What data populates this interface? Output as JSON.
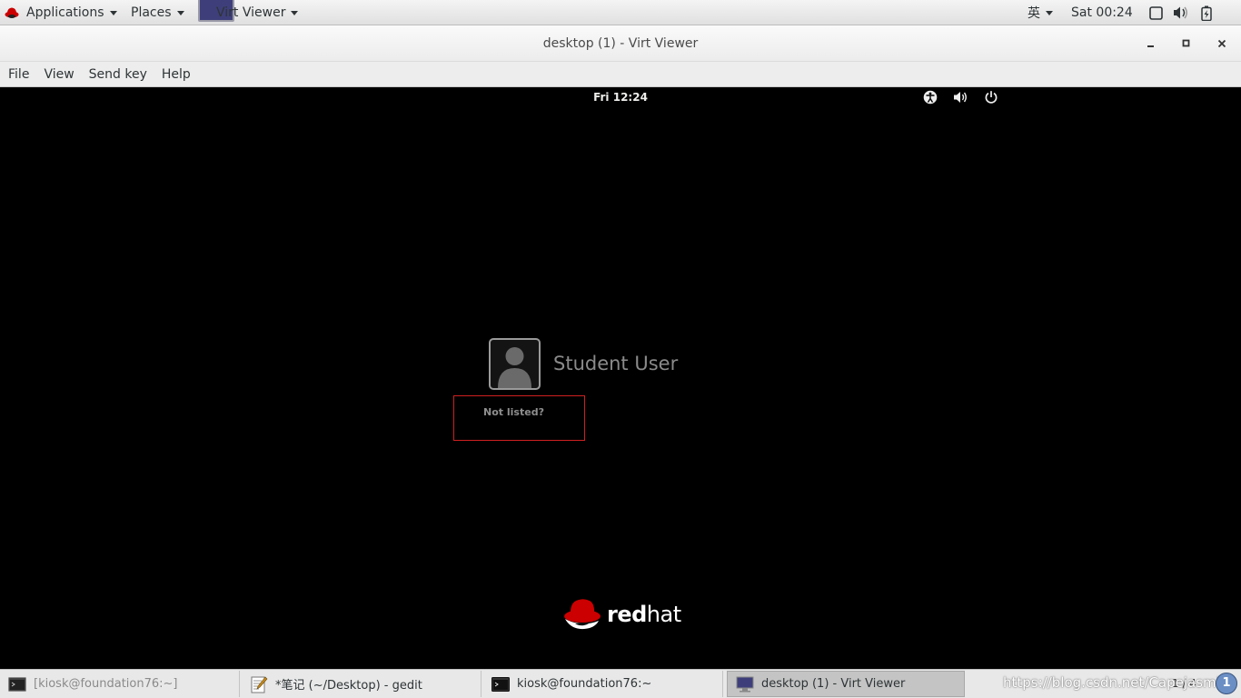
{
  "top_panel": {
    "applications_label": "Applications",
    "places_label": "Places",
    "active_app_label": "Virt Viewer",
    "input_method": "英",
    "clock": "Sat 00:24",
    "tray_icons": [
      "window-icon",
      "volume-icon",
      "battery-icon"
    ]
  },
  "window": {
    "title": "desktop (1) - Virt Viewer",
    "menus": [
      "File",
      "View",
      "Send key",
      "Help"
    ]
  },
  "guest": {
    "clock": "Fri 12:24",
    "user_name": "Student User",
    "not_listed_label": "Not listed?",
    "brand_red": "red",
    "brand_hat": "hat",
    "highlight_color": "#d02020"
  },
  "taskbar": {
    "tasks": [
      {
        "label": "[kiosk@foundation76:~]",
        "icon": "terminal-icon",
        "state": "minimized"
      },
      {
        "label": "*笔记 (~/Desktop) - gedit",
        "icon": "text-editor-icon",
        "state": "normal"
      },
      {
        "label": "kiosk@foundation76:~",
        "icon": "terminal-icon",
        "state": "normal"
      },
      {
        "label": "desktop (1) - Virt Viewer",
        "icon": "virt-viewer-icon",
        "state": "active"
      }
    ],
    "workspace": "1 / 4",
    "watermark": "https://blog.csdn.net/Capejasmine"
  }
}
